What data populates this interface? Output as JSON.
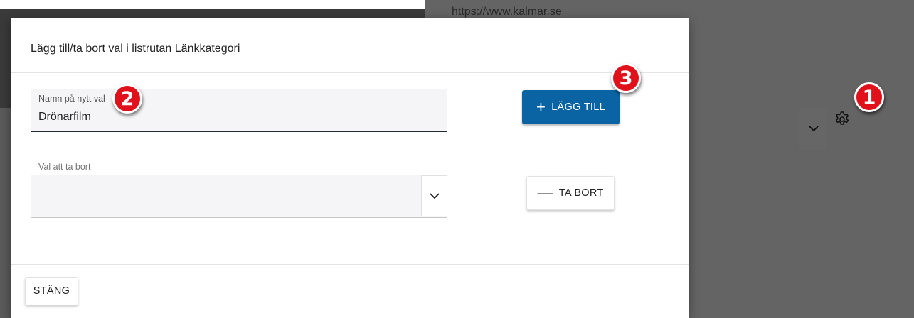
{
  "background": {
    "url_text": "https://www.kalmar.se"
  },
  "dialog": {
    "title": "Lägg till/ta bort val i listrutan Länkkategori",
    "new_value_field": {
      "label": "Namn på nytt val",
      "value": "Drönarfilm"
    },
    "add_button": {
      "icon": "plus-icon",
      "label": "LÄGG TILL"
    },
    "remove_field": {
      "label": "Val att ta bort",
      "value": ""
    },
    "remove_button": {
      "icon": "minus-icon",
      "label": "TA BORT"
    },
    "close_button": {
      "label": "STÄNG"
    }
  },
  "annotations": [
    {
      "number": "1",
      "color": "#e0111a"
    },
    {
      "number": "2",
      "color": "#e0111a"
    },
    {
      "number": "3",
      "color": "#e0111a"
    }
  ],
  "colors": {
    "primary": "#0a64a4",
    "overlay": "#646464"
  }
}
